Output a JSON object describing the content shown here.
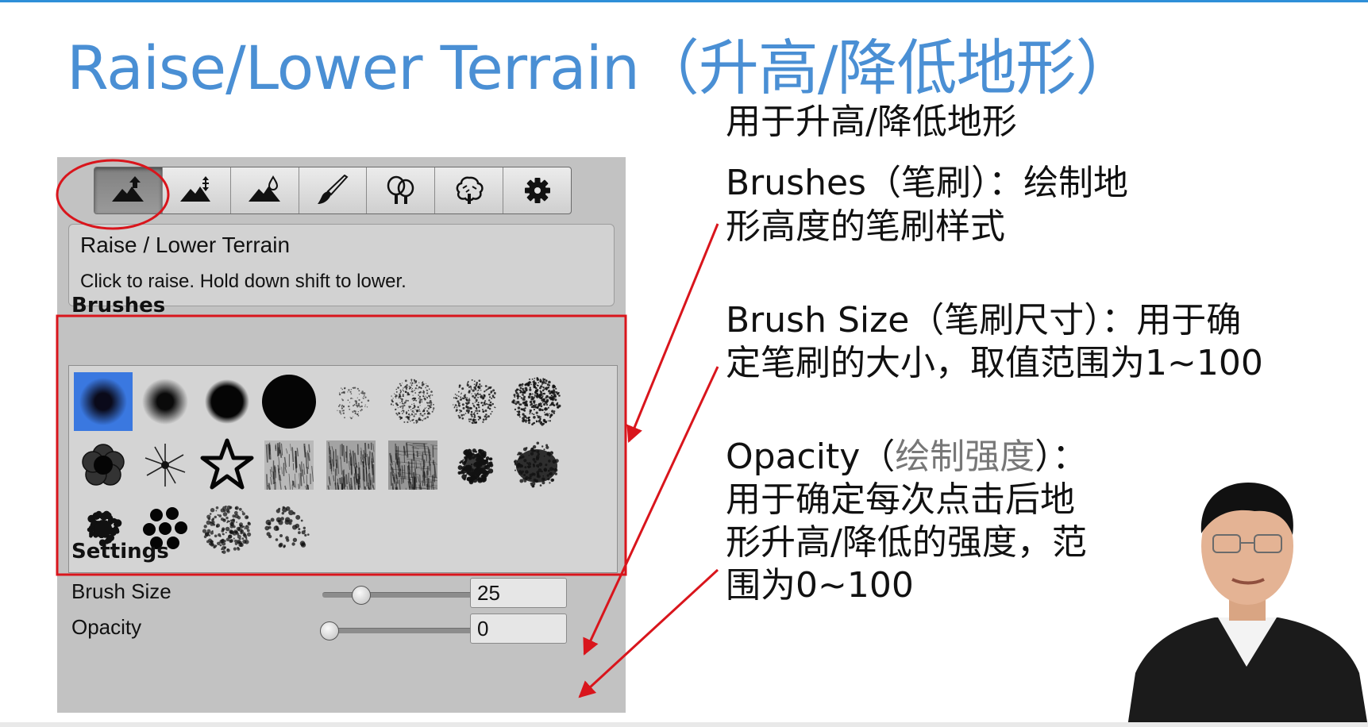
{
  "slide": {
    "title": "Raise/Lower Terrain（升高/降低地形）",
    "accent_color": "#4a8fd4",
    "highlight_color": "#d9151c"
  },
  "toolbar": {
    "tools": [
      {
        "name": "raise-lower-terrain",
        "icon": "mountain-up-arrow-icon",
        "active": true
      },
      {
        "name": "paint-height",
        "icon": "mountain-height-arrows-icon",
        "active": false
      },
      {
        "name": "smooth-height",
        "icon": "mountain-drop-icon",
        "active": false
      },
      {
        "name": "paint-texture",
        "icon": "paintbrush-icon",
        "active": false
      },
      {
        "name": "place-trees",
        "icon": "trees-icon",
        "active": false
      },
      {
        "name": "paint-details",
        "icon": "bush-icon",
        "active": false
      },
      {
        "name": "terrain-settings",
        "icon": "gear-icon",
        "active": false
      }
    ]
  },
  "help": {
    "title": "Raise / Lower Terrain",
    "text": "Click to raise. Hold down shift to lower."
  },
  "brushes": {
    "label": "Brushes",
    "selected_index": 0,
    "items": [
      "soft-blue-dot",
      "soft-circle",
      "hard-soft-circle",
      "hard-circle",
      "sparse-noise",
      "dense-noise",
      "speckle-noise",
      "heavy-noise",
      "flower-blob",
      "starburst",
      "star-outline",
      "grain-square",
      "grain-square-dense",
      "streak-square",
      "splatter",
      "dark-cloud",
      "dot-cluster",
      "big-dots",
      "scatter-ring",
      "scatter-light"
    ]
  },
  "settings": {
    "label": "Settings",
    "brush_size": {
      "label": "Brush Size",
      "value": "25",
      "fraction": 0.24
    },
    "opacity": {
      "label": "Opacity",
      "value": "0",
      "fraction": 0.04
    }
  },
  "notes": {
    "purpose": "用于升高/降低地形",
    "brushes_1": "Brushes（笔刷）：绘制地",
    "brushes_2": "形高度的笔刷样式",
    "size_1": "Brush Size（笔刷尺寸）：用于确",
    "size_2": "定笔刷的大小，取值范围为1~100",
    "opacity_prefix": "Opacity（",
    "opacity_accent": "绘制强度",
    "opacity_suffix": "）：",
    "opacity_2": "用于确定每次点击后地",
    "opacity_3": "形升高/降低的强度，范",
    "opacity_4": "围为0~100"
  }
}
